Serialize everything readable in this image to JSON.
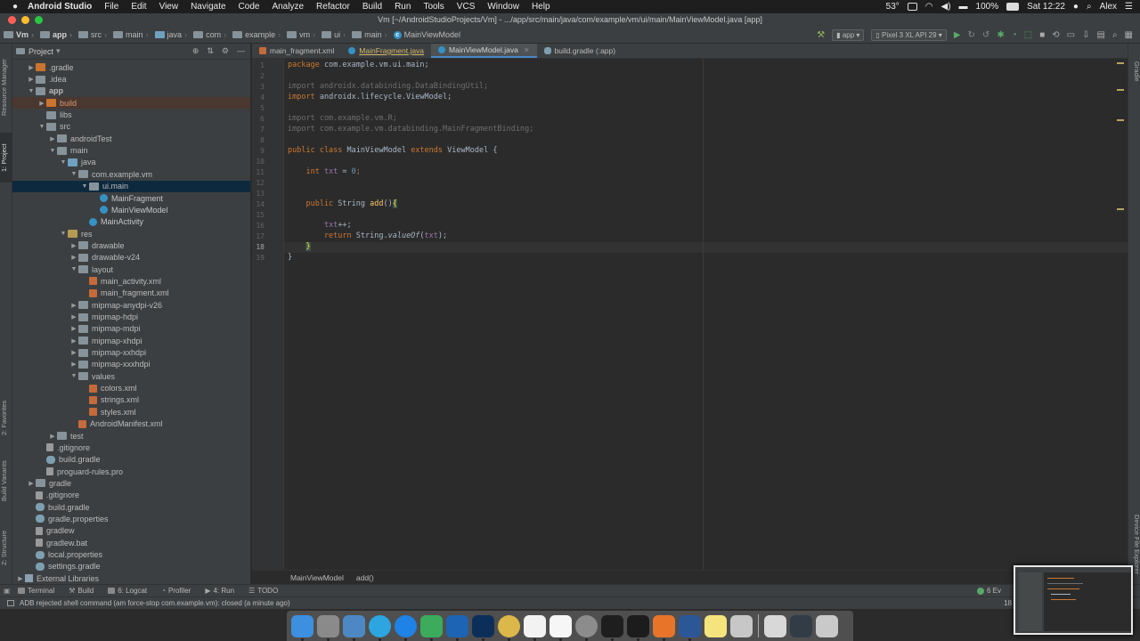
{
  "menubar": {
    "app_name": "Android Studio",
    "items": [
      "File",
      "Edit",
      "View",
      "Navigate",
      "Code",
      "Analyze",
      "Refactor",
      "Build",
      "Run",
      "Tools",
      "VCS",
      "Window",
      "Help"
    ],
    "temperature": "53°",
    "battery": "100%",
    "clock": "Sat 12:22",
    "user": "Alex"
  },
  "window": {
    "title": "Vm [~/AndroidStudioProjects/Vm] - .../app/src/main/java/com/example/vm/ui/main/MainViewModel.java [app]"
  },
  "navbar": {
    "crumbs": [
      "Vm",
      "app",
      "src",
      "main",
      "java",
      "com",
      "example",
      "vm",
      "ui",
      "main",
      "MainViewModel"
    ],
    "run_config": "app",
    "device": "Pixel 3 XL API 29"
  },
  "left_stripe": {
    "tabs": [
      "Resource Manager",
      "1: Project",
      "2: Favorites",
      "Build Variants",
      "Z: Structure"
    ]
  },
  "right_stripe": {
    "tabs": [
      "Gradle",
      "Device File Explorer"
    ]
  },
  "project_panel": {
    "title": "Project",
    "tree": [
      {
        "label": ".gradle",
        "depth": 1,
        "arrow": "▶",
        "icon": "folder-orange"
      },
      {
        "label": ".idea",
        "depth": 1,
        "arrow": "▶",
        "icon": "folder"
      },
      {
        "label": "app",
        "depth": 1,
        "arrow": "▼",
        "icon": "folder",
        "bold": true
      },
      {
        "label": "build",
        "depth": 2,
        "arrow": "▶",
        "icon": "folder-orange",
        "highlight": true
      },
      {
        "label": "libs",
        "depth": 2,
        "arrow": "",
        "icon": "folder"
      },
      {
        "label": "src",
        "depth": 2,
        "arrow": "▼",
        "icon": "folder"
      },
      {
        "label": "androidTest",
        "depth": 3,
        "arrow": "▶",
        "icon": "folder"
      },
      {
        "label": "main",
        "depth": 3,
        "arrow": "▼",
        "icon": "folder"
      },
      {
        "label": "java",
        "depth": 4,
        "arrow": "▼",
        "icon": "folder-src"
      },
      {
        "label": "com.example.vm",
        "depth": 5,
        "arrow": "▼",
        "icon": "folder"
      },
      {
        "label": "ui.main",
        "depth": 6,
        "arrow": "▼",
        "icon": "folder",
        "selected": true
      },
      {
        "label": "MainFragment",
        "depth": 7,
        "arrow": "",
        "icon": "class"
      },
      {
        "label": "MainViewModel",
        "depth": 7,
        "arrow": "",
        "icon": "class"
      },
      {
        "label": "MainActivity",
        "depth": 6,
        "arrow": "",
        "icon": "class"
      },
      {
        "label": "res",
        "depth": 4,
        "arrow": "▼",
        "icon": "folder-res"
      },
      {
        "label": "drawable",
        "depth": 5,
        "arrow": "▶",
        "icon": "folder"
      },
      {
        "label": "drawable-v24",
        "depth": 5,
        "arrow": "▶",
        "icon": "folder"
      },
      {
        "label": "layout",
        "depth": 5,
        "arrow": "▼",
        "icon": "folder"
      },
      {
        "label": "main_activity.xml",
        "depth": 6,
        "arrow": "",
        "icon": "xml"
      },
      {
        "label": "main_fragment.xml",
        "depth": 6,
        "arrow": "",
        "icon": "xml"
      },
      {
        "label": "mipmap-anydpi-v26",
        "depth": 5,
        "arrow": "▶",
        "icon": "folder"
      },
      {
        "label": "mipmap-hdpi",
        "depth": 5,
        "arrow": "▶",
        "icon": "folder"
      },
      {
        "label": "mipmap-mdpi",
        "depth": 5,
        "arrow": "▶",
        "icon": "folder"
      },
      {
        "label": "mipmap-xhdpi",
        "depth": 5,
        "arrow": "▶",
        "icon": "folder"
      },
      {
        "label": "mipmap-xxhdpi",
        "depth": 5,
        "arrow": "▶",
        "icon": "folder"
      },
      {
        "label": "mipmap-xxxhdpi",
        "depth": 5,
        "arrow": "▶",
        "icon": "folder"
      },
      {
        "label": "values",
        "depth": 5,
        "arrow": "▼",
        "icon": "folder"
      },
      {
        "label": "colors.xml",
        "depth": 6,
        "arrow": "",
        "icon": "xml"
      },
      {
        "label": "strings.xml",
        "depth": 6,
        "arrow": "",
        "icon": "xml"
      },
      {
        "label": "styles.xml",
        "depth": 6,
        "arrow": "",
        "icon": "xml"
      },
      {
        "label": "AndroidManifest.xml",
        "depth": 5,
        "arrow": "",
        "icon": "xml"
      },
      {
        "label": "test",
        "depth": 3,
        "arrow": "▶",
        "icon": "folder"
      },
      {
        "label": ".gitignore",
        "depth": 2,
        "arrow": "",
        "icon": "file"
      },
      {
        "label": "build.gradle",
        "depth": 2,
        "arrow": "",
        "icon": "gradle"
      },
      {
        "label": "proguard-rules.pro",
        "depth": 2,
        "arrow": "",
        "icon": "file"
      },
      {
        "label": "gradle",
        "depth": 1,
        "arrow": "▶",
        "icon": "folder"
      },
      {
        "label": ".gitignore",
        "depth": 1,
        "arrow": "",
        "icon": "file"
      },
      {
        "label": "build.gradle",
        "depth": 1,
        "arrow": "",
        "icon": "gradle"
      },
      {
        "label": "gradle.properties",
        "depth": 1,
        "arrow": "",
        "icon": "gradle"
      },
      {
        "label": "gradlew",
        "depth": 1,
        "arrow": "",
        "icon": "file"
      },
      {
        "label": "gradlew.bat",
        "depth": 1,
        "arrow": "",
        "icon": "file"
      },
      {
        "label": "local.properties",
        "depth": 1,
        "arrow": "",
        "icon": "gradle"
      },
      {
        "label": "settings.gradle",
        "depth": 1,
        "arrow": "",
        "icon": "gradle"
      },
      {
        "label": "External Libraries",
        "depth": 0,
        "arrow": "▶",
        "icon": "lib"
      }
    ]
  },
  "tabs": [
    {
      "label": "main_fragment.xml",
      "icon": "xml",
      "active": false,
      "warn": false
    },
    {
      "label": "MainFragment.java",
      "icon": "class",
      "active": false,
      "warn": true
    },
    {
      "label": "MainViewModel.java",
      "icon": "class",
      "active": true,
      "warn": false
    },
    {
      "label": "build.gradle (:app)",
      "icon": "gradle",
      "active": false,
      "warn": false
    }
  ],
  "editor": {
    "current_line": "18",
    "line_numbers": [
      "1",
      "2",
      "3",
      "4",
      "5",
      "6",
      "7",
      "8",
      "9",
      "10",
      "11",
      "12",
      "13",
      "14",
      "15",
      "16",
      "17",
      "18",
      "19"
    ],
    "lines": [
      [
        {
          "t": "package ",
          "c": "kw"
        },
        {
          "t": "com.example.vm.ui.main;",
          "c": ""
        }
      ],
      [],
      [
        {
          "t": "import androidx.databinding.DataBindingUtil;",
          "c": "dim"
        }
      ],
      [
        {
          "t": "import ",
          "c": "kw"
        },
        {
          "t": "androidx.lifecycle.ViewModel;",
          "c": ""
        }
      ],
      [],
      [
        {
          "t": "import com.example.vm.R;",
          "c": "dim"
        }
      ],
      [
        {
          "t": "import com.example.vm.databinding.MainFragmentBinding;",
          "c": "dim"
        }
      ],
      [],
      [
        {
          "t": "public class ",
          "c": "kw"
        },
        {
          "t": "MainViewModel ",
          "c": ""
        },
        {
          "t": "extends ",
          "c": "kw"
        },
        {
          "t": "ViewModel {",
          "c": ""
        }
      ],
      [],
      [
        {
          "t": "    int ",
          "c": "kw"
        },
        {
          "t": "txt",
          "c": "fld"
        },
        {
          "t": " = ",
          "c": ""
        },
        {
          "t": "0",
          "c": "num"
        },
        {
          "t": ";",
          "c": "kw"
        }
      ],
      [],
      [],
      [
        {
          "t": "    public ",
          "c": "kw"
        },
        {
          "t": "String ",
          "c": ""
        },
        {
          "t": "add",
          "c": "fn"
        },
        {
          "t": "()",
          "c": ""
        },
        {
          "t": "{",
          "c": "brace"
        }
      ],
      [],
      [
        {
          "t": "        ",
          "c": ""
        },
        {
          "t": "txt",
          "c": "fld"
        },
        {
          "t": "++;",
          "c": ""
        }
      ],
      [
        {
          "t": "        return ",
          "c": "kw"
        },
        {
          "t": "String.",
          "c": ""
        },
        {
          "t": "valueOf",
          "c": "it"
        },
        {
          "t": "(",
          "c": ""
        },
        {
          "t": "txt",
          "c": "fld"
        },
        {
          "t": ");",
          "c": ""
        }
      ],
      [
        {
          "t": "    ",
          "c": ""
        },
        {
          "t": "}",
          "c": "brace"
        }
      ],
      [
        {
          "t": "}",
          "c": ""
        }
      ]
    ],
    "breadcrumb": [
      "MainViewModel",
      "add()"
    ]
  },
  "bottom_tools": {
    "items": [
      {
        "label": "Terminal"
      },
      {
        "label": "Build"
      },
      {
        "label": "6: Logcat"
      },
      {
        "label": "Profiler"
      },
      {
        "label": "4: Run"
      },
      {
        "label": "TODO"
      }
    ],
    "event_log": "6 Ev"
  },
  "status": {
    "message": "ADB rejected shell command (am force-stop com.example.vm): closed (a minute ago)",
    "position": "18"
  },
  "dock": {
    "apps": [
      "finder",
      "launchpad",
      "preview",
      "telegram",
      "safari",
      "android-studio",
      "virtualbox",
      "photoshop",
      "chrome",
      "reminders",
      "calendar",
      "system-preferences",
      "activity-monitor",
      "terminal",
      "vlc",
      "word",
      "stickies",
      "migration",
      "finder-window",
      "monitor",
      "trash"
    ],
    "colors": [
      "#3d8fe0",
      "#8a8a8a",
      "#4e88c4",
      "#2ca5e0",
      "#1e82e6",
      "#3dab5c",
      "#1d64b4",
      "#0c2f5a",
      "#dcb74a",
      "#f2f2f2",
      "#f6f6f6",
      "#8c8c8c",
      "#1e1e1e",
      "#1c1c1c",
      "#e8742a",
      "#2b5797",
      "#f5e47c",
      "#c7c7c7",
      "#d8d8d8",
      "#323c46",
      "#c9c9c9"
    ]
  }
}
